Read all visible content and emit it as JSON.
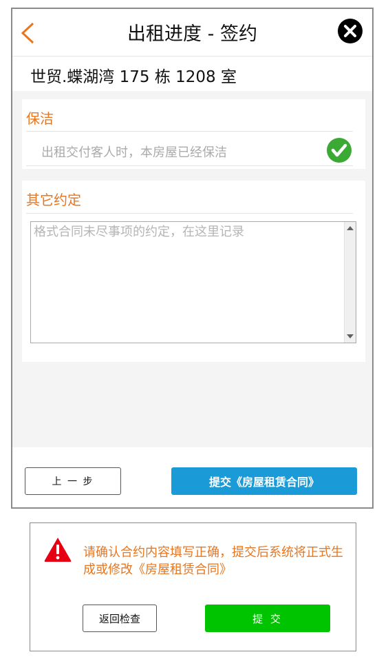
{
  "header": {
    "title": "出租进度 - 签约",
    "back_icon": "chevron-left-icon",
    "close_icon": "close-circle-icon",
    "accent_color": "#e8761e"
  },
  "property": {
    "address": "世贸.蝶湖湾   175 栋 1208 室"
  },
  "cleaning": {
    "section_title": "保洁",
    "statement": "出租交付客人时，本房屋已经保洁",
    "checked": true,
    "check_icon": "check-circle-icon",
    "check_color": "#3aaa35"
  },
  "other_terms": {
    "section_title": "其它约定",
    "value": "",
    "placeholder": "格式合同未尽事项的约定，在这里记录"
  },
  "footer": {
    "prev_label": "上 一 步",
    "submit_label": "提交《房屋租赁合同》",
    "submit_color": "#1a9ad6"
  },
  "dialog": {
    "warning_icon": "warning-triangle-icon",
    "message": "请确认合约内容填写正确，提交后系统将正式生成或修改《房屋租赁合同》",
    "back_label": "返回检查",
    "confirm_label": "提 交",
    "confirm_color": "#00c400"
  }
}
